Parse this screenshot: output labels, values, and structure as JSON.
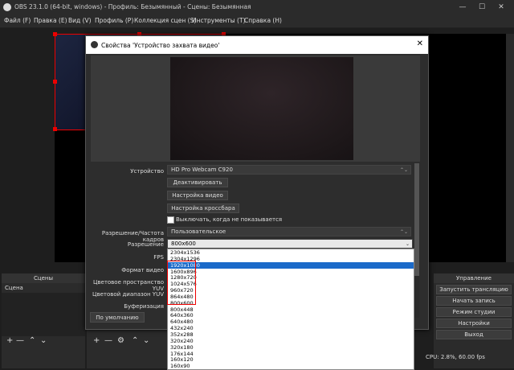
{
  "window": {
    "title": "OBS 23.1.0 (64-bit, windows) - Профиль: Безымянный - Сцены: Безымянная",
    "minimize": "—",
    "maximize": "☐",
    "close": "✕"
  },
  "menu": [
    "Файл (F)",
    "Правка (E)",
    "Вид (V)",
    "Профиль (P)",
    "Коллекция сцен (S)",
    "Инструменты (T)",
    "Справка (H)"
  ],
  "scenes_dock": {
    "title": "Сцены",
    "items": [
      "Сцена"
    ]
  },
  "controls_dock": {
    "title": "Управление",
    "buttons": [
      "Запустить трансляцию",
      "Начать запись",
      "Режим студии",
      "Настройки",
      "Выход"
    ]
  },
  "status": {
    "cpu": "CPU: 2.8%, 60.00 fps",
    "partial": "0"
  },
  "dialog": {
    "title": "Свойства 'Устройство захвата видео'",
    "close": "✕",
    "device_label": "Устройство",
    "device_value": "HD Pro Webcam C920",
    "deactivate_btn": "Деактивировать",
    "video_settings_btn": "Настройка видео",
    "crossbar_btn": "Настройка кроссбара",
    "deactivate_when_hidden": "Выключать, когда не показывается",
    "res_fps_label": "Разрешение/Частота кадров",
    "res_fps_value": "Пользовательское",
    "resolution_label": "Разрешение",
    "resolution_value": "800x600",
    "fps_label": "FPS",
    "video_format_label": "Формат видео",
    "color_space_label": "Цветовое пространство YUV",
    "color_range_label": "Цветовой диапазон YUV",
    "buffering_label": "Буферизация",
    "defaults_btn": "По умолчанию"
  },
  "resolution_options": [
    "2304x1536",
    "2304x1296",
    "1920x1080",
    "1600x896",
    "1280x720",
    "1024x576",
    "960x720",
    "864x480",
    "800x600",
    "800x448",
    "640x360",
    "640x480",
    "432x240",
    "352x288",
    "320x240",
    "320x180",
    "176x144",
    "160x120",
    "160x90"
  ],
  "selected_resolution": "1920x1080"
}
